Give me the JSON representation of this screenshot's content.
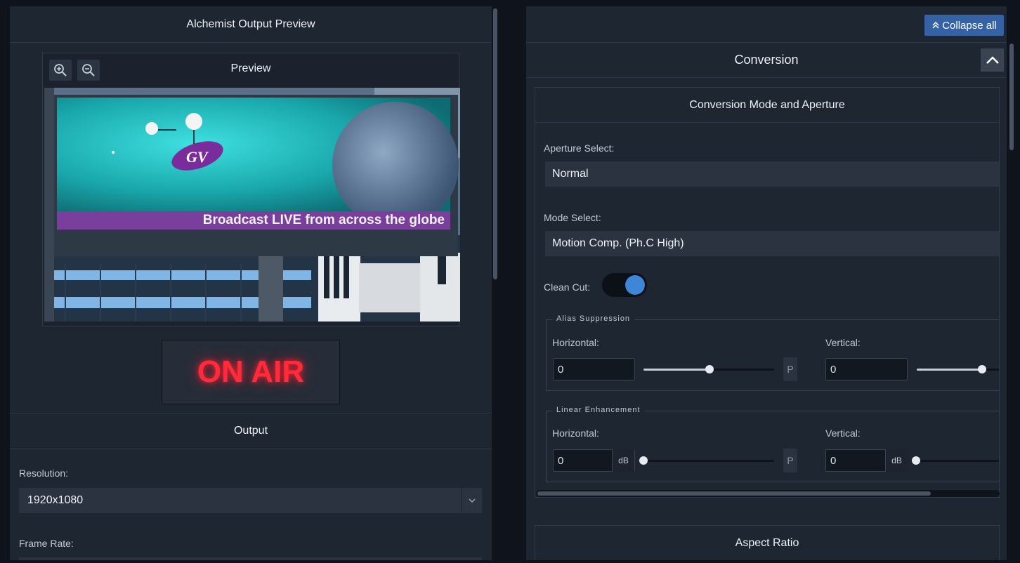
{
  "left": {
    "title": "Alchemist Output Preview",
    "preview": {
      "title": "Preview",
      "banner_text": "Broadcast LIVE from across the globe"
    },
    "onair": "ON AIR",
    "output": {
      "title": "Output",
      "resolution_label": "Resolution:",
      "resolution_value": "1920x1080",
      "frame_rate_label": "Frame Rate:"
    }
  },
  "right": {
    "collapse_all": "Collapse all",
    "conversion": {
      "title": "Conversion",
      "mode_aperture": {
        "title": "Conversion Mode and Aperture",
        "aperture_label": "Aperture Select:",
        "aperture_value": "Normal",
        "mode_label": "Mode Select:",
        "mode_value": "Motion Comp. (Ph.C High)",
        "clean_cut_label": "Clean Cut:",
        "clean_cut_on": true,
        "alias": {
          "legend": "Alias Suppression",
          "horizontal_label": "Horizontal:",
          "horizontal_value": "0",
          "vertical_label": "Vertical:",
          "vertical_value": "0",
          "p_label": "P"
        },
        "linear": {
          "legend": "Linear Enhancement",
          "horizontal_label": "Horizontal:",
          "horizontal_value": "0",
          "horizontal_unit": "dB",
          "vertical_label": "Vertical:",
          "vertical_value": "0",
          "vertical_unit": "dB",
          "p_label": "P"
        }
      },
      "aspect_ratio": {
        "title": "Aspect Ratio"
      }
    }
  },
  "colors": {
    "accent": "#3462a5",
    "toggle_on": "#3d86d8",
    "onair": "#ff2b3a"
  },
  "icons": [
    "zoom-in-icon",
    "zoom-out-icon",
    "double-chevron-up-icon",
    "chevron-up-icon",
    "dropdown-chevron-icon"
  ]
}
